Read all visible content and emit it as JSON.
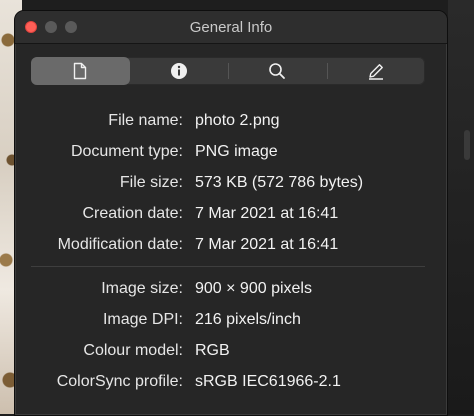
{
  "window": {
    "title": "General Info"
  },
  "toolbar": {
    "tabs": [
      {
        "icon": "document-icon",
        "active": true
      },
      {
        "icon": "info-icon",
        "active": false
      },
      {
        "icon": "magnifier-icon",
        "active": false
      },
      {
        "icon": "pencil-icon",
        "active": false
      }
    ]
  },
  "general": [
    {
      "label": "File name:",
      "value": "photo 2.png"
    },
    {
      "label": "Document type:",
      "value": "PNG image"
    },
    {
      "label": "File size:",
      "value": "573 KB (572 786 bytes)"
    },
    {
      "label": "Creation date:",
      "value": "7 Mar 2021 at 16:41"
    },
    {
      "label": "Modification date:",
      "value": "7 Mar 2021 at 16:41"
    }
  ],
  "image": [
    {
      "label": "Image size:",
      "value": "900 × 900 pixels"
    },
    {
      "label": "Image DPI:",
      "value": "216 pixels/inch"
    },
    {
      "label": "Colour model:",
      "value": "RGB"
    },
    {
      "label": "ColorSync profile:",
      "value": "sRGB IEC61966-2.1"
    }
  ],
  "colors": {
    "close": "#ff5f57",
    "active_tab": "#6a6a6a"
  }
}
